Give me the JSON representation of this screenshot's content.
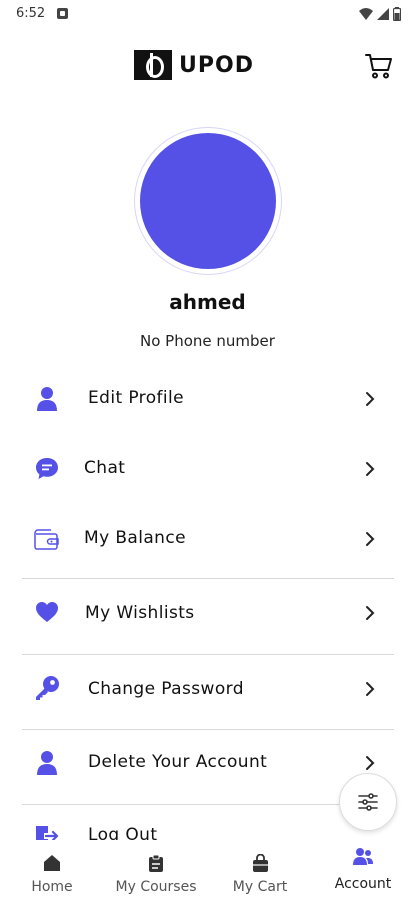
{
  "status_bar": {
    "time": "6:52"
  },
  "header": {
    "logo_text": "UPOD"
  },
  "profile": {
    "name": "ahmed",
    "phone": "No Phone number",
    "avatar_color": "#5551e6"
  },
  "menu": {
    "items": [
      {
        "label": "Edit Profile",
        "icon": "person-icon"
      },
      {
        "label": "Chat",
        "icon": "chat-icon"
      },
      {
        "label": "My Balance",
        "icon": "wallet-icon"
      },
      {
        "label": "My Wishlists",
        "icon": "heart-icon"
      },
      {
        "label": "Change Password",
        "icon": "key-icon"
      },
      {
        "label": "Delete Your Account",
        "icon": "person-icon"
      },
      {
        "label": "Log Out",
        "icon": "logout-icon"
      }
    ]
  },
  "bottom_nav": {
    "items": [
      {
        "label": "Home",
        "icon": "home-icon"
      },
      {
        "label": "My Courses",
        "icon": "clipboard-icon"
      },
      {
        "label": "My Cart",
        "icon": "bag-icon"
      },
      {
        "label": "Account",
        "icon": "people-icon",
        "active": true
      }
    ]
  },
  "colors": {
    "accent": "#5551e6",
    "divider": "#d9d9d9"
  }
}
